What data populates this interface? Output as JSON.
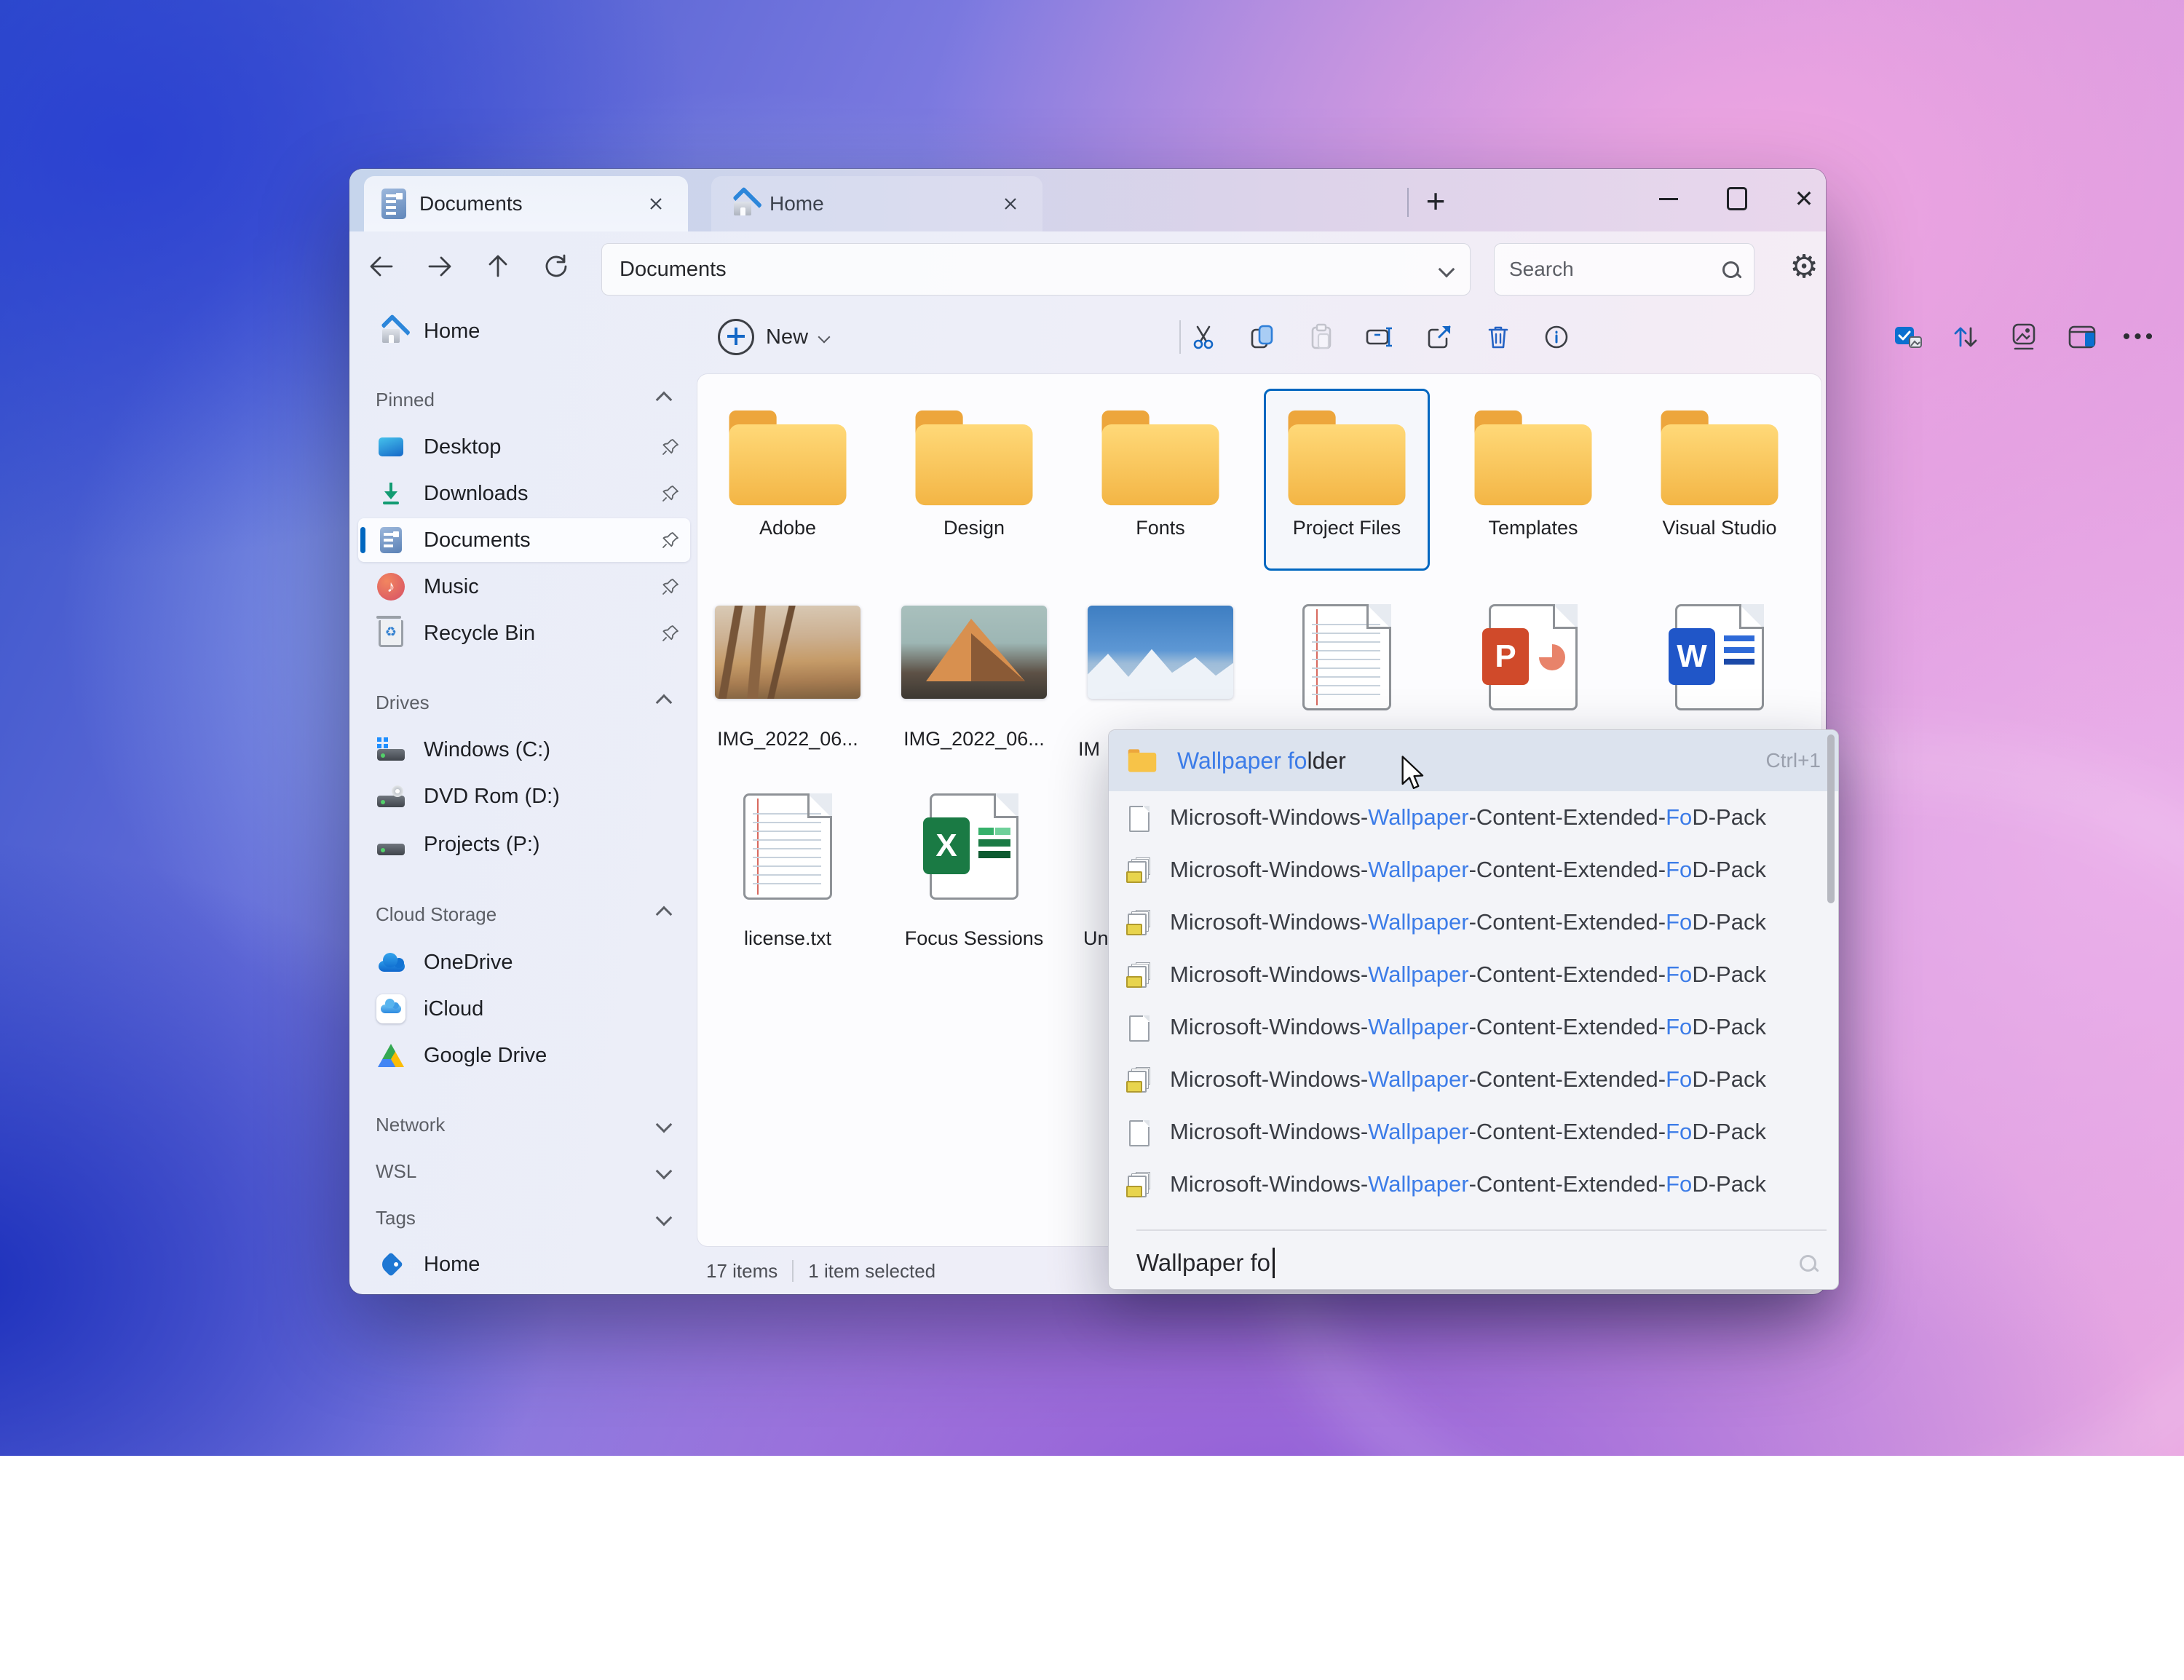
{
  "tabs": {
    "documents": {
      "label": "Documents"
    },
    "home": {
      "label": "Home"
    }
  },
  "navigation": {
    "address": "Documents",
    "search_placeholder": "Search"
  },
  "toolbar": {
    "new_label": "New"
  },
  "sidebar": {
    "home": "Home",
    "pinned_title": "Pinned",
    "desktop": "Desktop",
    "downloads": "Downloads",
    "documents": "Documents",
    "music": "Music",
    "recycle_bin": "Recycle Bin",
    "drives_title": "Drives",
    "windows_c": "Windows (C:)",
    "dvd_rom": "DVD Rom (D:)",
    "projects": "Projects (P:)",
    "cloud_title": "Cloud Storage",
    "onedrive": "OneDrive",
    "icloud": "iCloud",
    "google_drive": "Google Drive",
    "network_title": "Network",
    "wsl_title": "WSL",
    "tags_title": "Tags",
    "tag_home": "Home"
  },
  "files": {
    "folders": [
      {
        "label": "Adobe"
      },
      {
        "label": "Design"
      },
      {
        "label": "Fonts"
      },
      {
        "label": "Project Files",
        "selected": "true"
      },
      {
        "label": "Templates"
      },
      {
        "label": "Visual Studio"
      }
    ],
    "image1_label": "IMG_2022_06...",
    "image2_label": "IMG_2022_06...",
    "image3_label_visible": "IM",
    "license_label": "license.txt",
    "excel_label": "Focus Sessions",
    "row3_item3_label_visible": "Un"
  },
  "statusbar": {
    "count": "17 items",
    "selected": "1 item selected"
  },
  "popup": {
    "first": {
      "match": "Wallpaper fo",
      "rest": "lder",
      "shortcut": "Ctrl+1"
    },
    "pattern": {
      "p1": "Microsoft-Windows-",
      "p2": "Wallpaper",
      "p3": "-Content-Extended-",
      "p4": "Fo",
      "p5": "D-Pack"
    },
    "suggestions": [
      {
        "icon": "file"
      },
      {
        "icon": "cab"
      },
      {
        "icon": "cab"
      },
      {
        "icon": "cab"
      },
      {
        "icon": "file"
      },
      {
        "icon": "cab"
      },
      {
        "icon": "file"
      },
      {
        "icon": "cab"
      }
    ],
    "input_value": "Wallpaper fo"
  },
  "colors": {
    "accent": "#0067c0",
    "match_blue": "#3c7ce8",
    "folder_yellow": "#f7c348"
  }
}
